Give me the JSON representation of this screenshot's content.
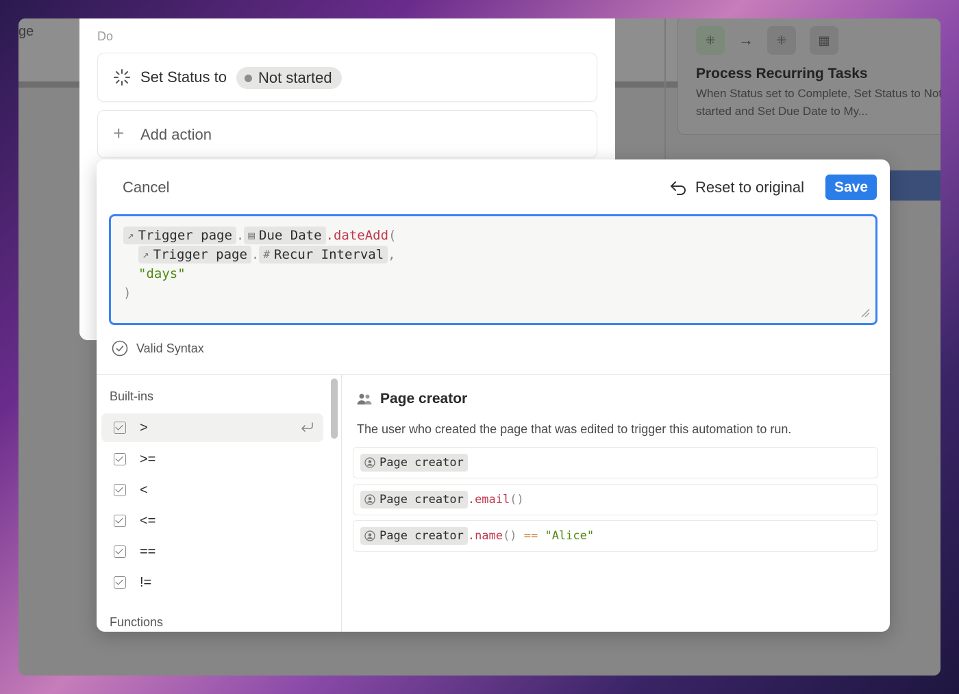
{
  "background_window": {
    "left_text": "ge",
    "card": {
      "title": "Process Recurring Tasks",
      "description": "When Status set to Complete, Set Status to Not started and Set Due Date to My..."
    }
  },
  "do_panel": {
    "label": "Do",
    "action": {
      "prefix": "Set Status to",
      "status": "Not started"
    },
    "add_action": "Add action"
  },
  "modal": {
    "cancel": "Cancel",
    "reset": "Reset to original",
    "save": "Save",
    "formula": {
      "line1": {
        "chip1": "Trigger page",
        "dot1": ".",
        "chip2": "Due Date",
        "fn": ".dateAdd",
        "paren": "("
      },
      "line2": {
        "chip1": "Trigger page",
        "dot1": ".",
        "chip2_icon": "#",
        "chip2": "Recur Interval",
        "comma": ","
      },
      "line3": {
        "str": "\"days\""
      },
      "line4": {
        "paren": ")"
      }
    },
    "validation": "Valid Syntax",
    "builtins_heading": "Built-ins",
    "builtins": [
      ">",
      ">=",
      "<",
      "<=",
      "==",
      "!="
    ],
    "functions_heading": "Functions",
    "detail": {
      "title": "Page creator",
      "description": "The user who created the page that was edited to trigger this automation to run.",
      "examples": [
        {
          "chip": "Page creator",
          "rest": ""
        },
        {
          "chip": "Page creator",
          "fn": ".email",
          "paren": "()"
        },
        {
          "chip": "Page creator",
          "fn": ".name",
          "paren": "()",
          "op": " == ",
          "str": "\"Alice\""
        }
      ]
    }
  },
  "colors": {
    "accent": "#2b7de9",
    "focus_border": "#3b82f6",
    "function_token": "#c0394d",
    "string_token": "#4f8a12"
  }
}
